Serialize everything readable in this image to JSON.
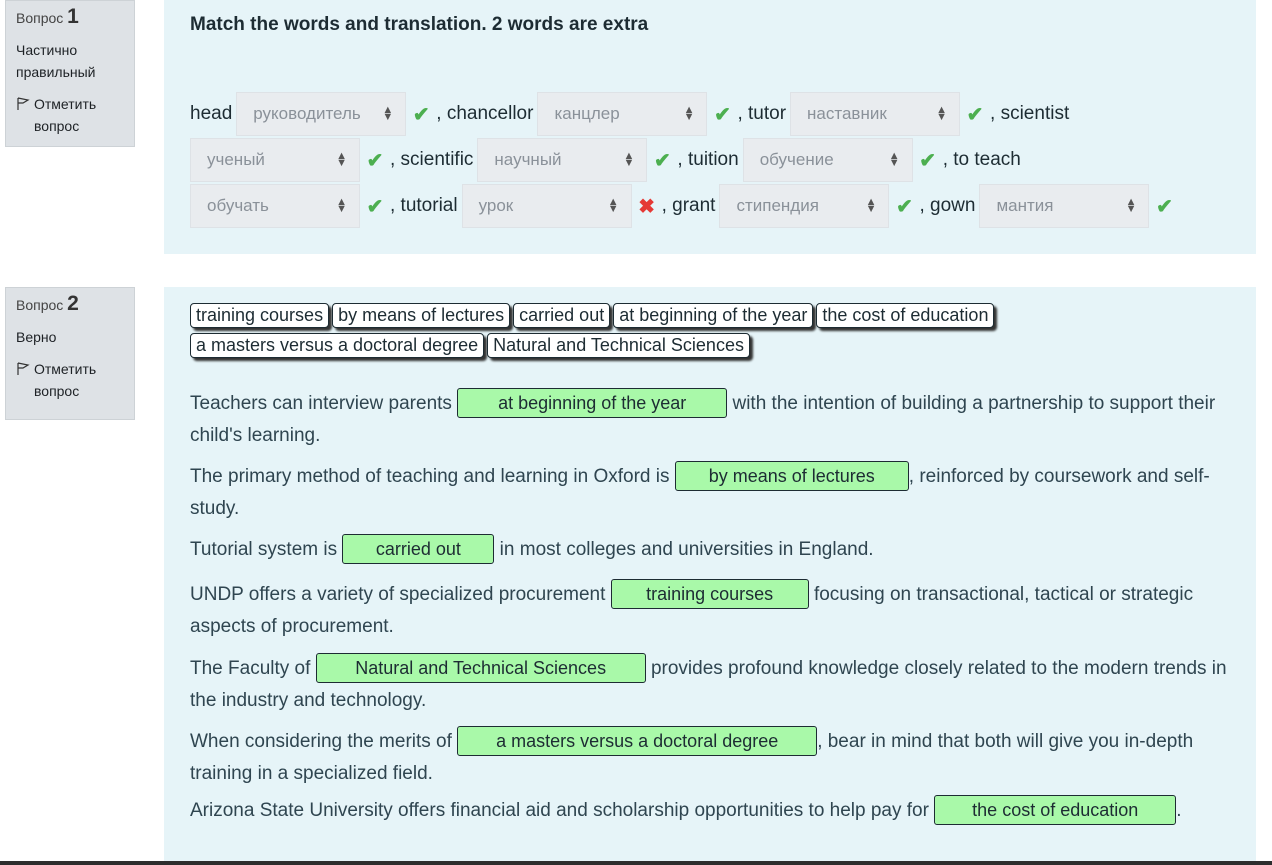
{
  "q1": {
    "label": "Вопрос",
    "number": "1",
    "state": "Частично правильный",
    "flag": "Отметить вопрос",
    "title": "Match the words and translation. 2 words are extra",
    "rows": [
      [
        {
          "word": "head",
          "answer": "руководитель",
          "correct": true
        },
        {
          "word": ", chancellor",
          "answer": "канцлер",
          "correct": true
        },
        {
          "word": ", tutor",
          "answer": "наставник",
          "correct": true
        },
        {
          "word": ", scientist",
          "answer": null,
          "correct": null
        }
      ],
      [
        {
          "word": "",
          "answer": "ученый",
          "correct": true
        },
        {
          "word": ", scientific",
          "answer": "научный",
          "correct": true
        },
        {
          "word": ", tuition",
          "answer": "обучение",
          "correct": true
        },
        {
          "word": ", to teach",
          "answer": null,
          "correct": null
        }
      ],
      [
        {
          "word": "",
          "answer": "обучать",
          "correct": true
        },
        {
          "word": ", tutorial",
          "answer": "урок",
          "correct": false
        },
        {
          "word": ", grant",
          "answer": "стипендия",
          "correct": true
        },
        {
          "word": ", gown",
          "answer": "мантия",
          "correct": true
        }
      ]
    ]
  },
  "q2": {
    "label": "Вопрос",
    "number": "2",
    "state": "Верно",
    "flag": "Отметить вопрос",
    "choices": [
      "training courses",
      "by means of lectures",
      "carried out",
      "at beginning of the year",
      "the cost of education",
      "a masters versus a doctoral degree",
      "Natural and Technical Sciences"
    ],
    "sentences": [
      {
        "before": "Teachers can interview parents",
        "answer": "at beginning of the year",
        "after": "with the intention of building a partnership to support their child's learning."
      },
      {
        "before": "The primary method of teaching and learning in Oxford is",
        "answer": "by means of lectures",
        "after": ", reinforced by coursework and self-study."
      },
      {
        "before": "Tutorial system is",
        "answer": "carried out",
        "after": "in most colleges and universities in England."
      },
      {
        "before": "UNDP offers a variety of specialized procurement",
        "answer": "training courses",
        "after": "focusing on transactional, tactical or strategic aspects of procurement."
      },
      {
        "before": "The Faculty of",
        "answer": "Natural and Technical Sciences",
        "after": "provides profound knowledge closely related to the modern trends in the industry and technology."
      },
      {
        "before": "When considering the merits of",
        "answer": "a masters versus a doctoral degree",
        "after": ", bear in mind that both will give you in-depth training in a specialized field."
      },
      {
        "before": "Arizona State University offers financial aid and scholarship opportunities to help pay for",
        "answer": "the cost of education",
        "after": "."
      }
    ]
  },
  "colors": {
    "info_bg": "#dee2e6",
    "content_bg": "#e6f4f8",
    "drop_bg": "#a9f9a9",
    "tick": "#4caf50",
    "cross": "#e53935"
  },
  "icons": {
    "correct": "check-icon",
    "incorrect": "cross-icon",
    "flag": "flag-icon",
    "select": "updown-arrow-icon"
  }
}
